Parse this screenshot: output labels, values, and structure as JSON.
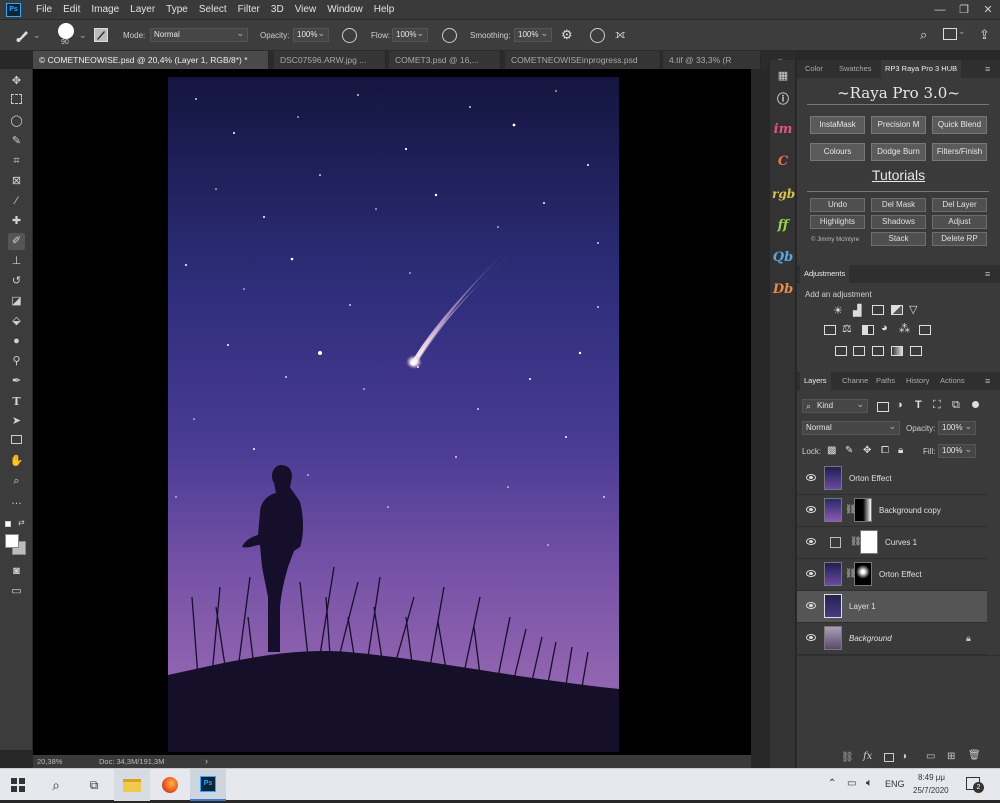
{
  "app": {
    "logo": "Ps"
  },
  "menu": [
    "File",
    "Edit",
    "Image",
    "Layer",
    "Type",
    "Select",
    "Filter",
    "3D",
    "View",
    "Window",
    "Help"
  ],
  "options": {
    "brush_size": "90",
    "mode_label": "Mode:",
    "mode_value": "Normal",
    "opacity_label": "Opacity:",
    "opacity_value": "100%",
    "flow_label": "Flow:",
    "flow_value": "100%",
    "smoothing_label": "Smoothing:",
    "smoothing_value": "100%"
  },
  "tabs": [
    {
      "label": "© COMETNEOWISE.psd @ 20,4% (Layer 1, RGB/8*) *",
      "active": true
    },
    {
      "label": "DSC07596.ARW.jpg ...",
      "active": false
    },
    {
      "label": "COMET3.psd @ 16,...",
      "active": false
    },
    {
      "label": "COMETNEOWISEinprogress.psd",
      "active": false
    },
    {
      "label": "4.tif @ 33,3% (R",
      "active": false
    }
  ],
  "status": {
    "zoom": "20,38%",
    "doc": "Doc: 34,3M/191,3M"
  },
  "raya": {
    "tabs": [
      "Color",
      "Swatches",
      "RP3 Raya Pro 3 HUB"
    ],
    "title": "~Raya Pro 3.0~",
    "row1": [
      "InstaMask",
      "Precision M",
      "Quick Blend"
    ],
    "row2": [
      "Colours",
      "Dodge Burn",
      "Filters/Finish"
    ],
    "tutorials": "Tutorials",
    "row3": [
      "Undo",
      "Del Mask",
      "Del Layer"
    ],
    "row4": [
      "Highlights",
      "Shadows",
      "Adjust"
    ],
    "row5": [
      "Stack",
      "Delete RP"
    ],
    "credit": "© Jimmy McIntyre"
  },
  "strip_icons": [
    {
      "icon": "arrange-icon",
      "glyph": "▦",
      "color": "#d0d0d0"
    },
    {
      "icon": "info-icon",
      "glyph": "ⓘ",
      "color": "#d0d0d0"
    },
    {
      "icon": "im-icon",
      "glyph": "im",
      "color": "#e0557c"
    },
    {
      "icon": "c-icon",
      "glyph": "C",
      "color": "#e8734a"
    },
    {
      "icon": "rgb-icon",
      "glyph": "rgb",
      "color": "#d8c34a"
    },
    {
      "icon": "ff-icon",
      "glyph": "ff",
      "color": "#9ad04a"
    },
    {
      "icon": "qb-icon",
      "glyph": "Qb",
      "color": "#5aa7e0"
    },
    {
      "icon": "db-icon",
      "glyph": "Db",
      "color": "#e88a4a"
    }
  ],
  "adjustments": {
    "tab": "Adjustments",
    "add_label": "Add an adjustment"
  },
  "layers_panel": {
    "tabs": [
      "Layers",
      "Channe",
      "Paths",
      "History",
      "Actions"
    ],
    "filter_kind": "Kind",
    "blend_mode": "Normal",
    "opacity_label": "Opacity:",
    "opacity_value": "100%",
    "lock_label": "Lock:",
    "fill_label": "Fill:",
    "fill_value": "100%",
    "layers": [
      {
        "name": "Orton Effect",
        "italic": false,
        "selected": false
      },
      {
        "name": "Background copy",
        "italic": false,
        "selected": false
      },
      {
        "name": "Curves 1",
        "italic": false,
        "selected": false
      },
      {
        "name": "Orton Effect",
        "italic": false,
        "selected": false
      },
      {
        "name": "Layer 1",
        "italic": false,
        "selected": true
      },
      {
        "name": "Background",
        "italic": true,
        "selected": false
      }
    ]
  },
  "taskbar": {
    "lang": "ENG",
    "time": "8:49 μμ",
    "date": "25/7/2020",
    "notif_count": "2"
  }
}
